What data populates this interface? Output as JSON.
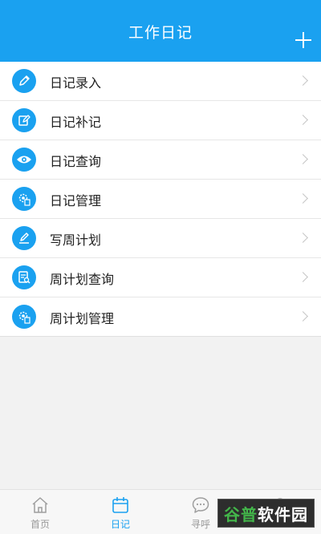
{
  "header": {
    "title": "工作日记"
  },
  "menu": {
    "items": [
      {
        "label": "日记录入",
        "icon": "pencil-icon"
      },
      {
        "label": "日记补记",
        "icon": "edit-note-icon"
      },
      {
        "label": "日记查询",
        "icon": "eye-icon"
      },
      {
        "label": "日记管理",
        "icon": "gear-doc-icon"
      },
      {
        "label": "写周计划",
        "icon": "write-pen-icon"
      },
      {
        "label": "周计划查询",
        "icon": "doc-search-icon"
      },
      {
        "label": "周计划管理",
        "icon": "gear-doc-icon"
      }
    ]
  },
  "tabbar": {
    "tabs": [
      {
        "label": "首页",
        "icon": "home-icon"
      },
      {
        "label": "日记",
        "icon": "calendar-icon",
        "active": true
      },
      {
        "label": "寻呼",
        "icon": "chat-icon"
      },
      {
        "label": "",
        "icon": "search-icon"
      }
    ]
  },
  "watermark": {
    "part1": "谷普",
    "part2": "软件园"
  },
  "colors": {
    "accent": "#1aa1f0",
    "background": "#f2f2f2",
    "watermark_green": "#43b64a"
  }
}
